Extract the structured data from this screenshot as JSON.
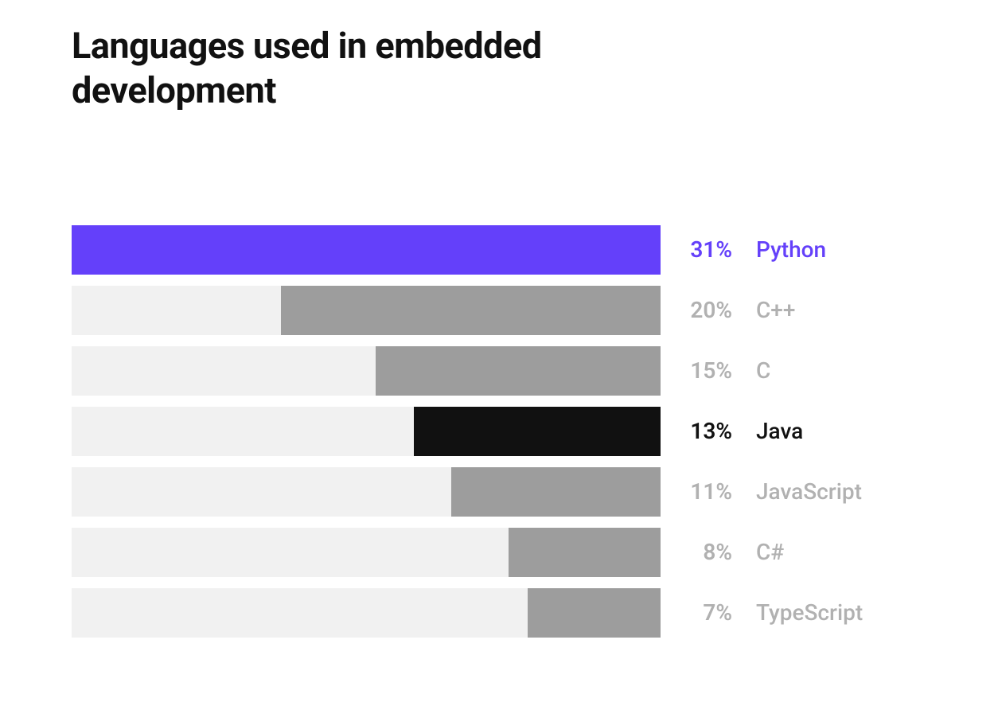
{
  "chart_data": {
    "type": "bar",
    "title": "Languages used in embedded development",
    "categories": [
      "Python",
      "C++",
      "C",
      "Java",
      "JavaScript",
      "C#",
      "TypeScript"
    ],
    "values": [
      31,
      20,
      15,
      13,
      11,
      8,
      7
    ],
    "value_suffix": "%",
    "max_value": 31,
    "series": [
      {
        "name": "Python",
        "value": 31,
        "style": "highlight"
      },
      {
        "name": "C++",
        "value": 20,
        "style": "muted"
      },
      {
        "name": "C",
        "value": 15,
        "style": "muted"
      },
      {
        "name": "Java",
        "value": 13,
        "style": "bold"
      },
      {
        "name": "JavaScript",
        "value": 11,
        "style": "muted"
      },
      {
        "name": "C#",
        "value": 8,
        "style": "muted"
      },
      {
        "name": "TypeScript",
        "value": 7,
        "style": "muted"
      }
    ],
    "colors": {
      "highlight": "#6440fa",
      "muted_bar": "#9d9d9d",
      "muted_text": "#b1b1b1",
      "bold": "#111111",
      "track": "#f1f1f1"
    }
  }
}
